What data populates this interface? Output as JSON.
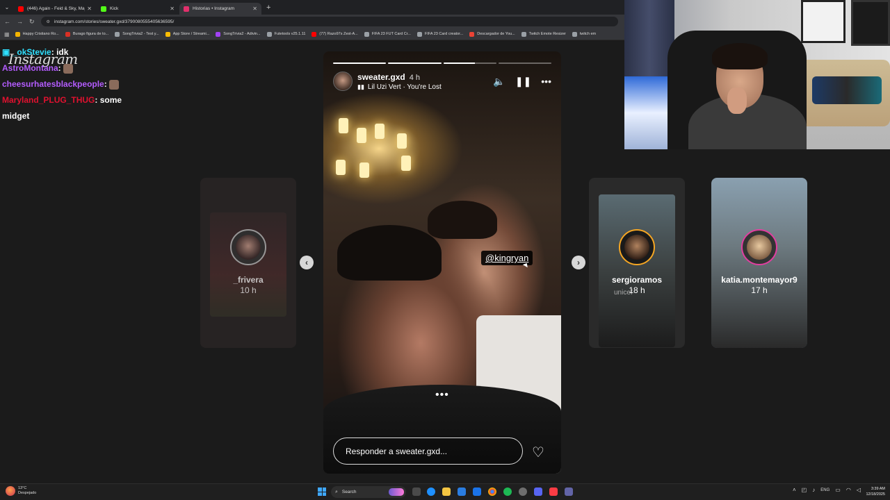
{
  "browser": {
    "tabs": [
      {
        "label": "(446) Again - Feid & Sky, Majo",
        "favicon_color": "#ff0000",
        "active": false
      },
      {
        "label": "Kick",
        "favicon_color": "#53fc18",
        "active": false
      },
      {
        "label": "Historias • Instagram",
        "favicon_color": "#e1306c",
        "active": true
      }
    ],
    "url": "instagram.com/stories/sweater.gxd/3790080555405636595/",
    "bookmarks": [
      {
        "label": "Happy Cristiano Ro...",
        "color": "#f4b400"
      },
      {
        "label": "Burago figura de to...",
        "color": "#d93025"
      },
      {
        "label": "SongTrivia2 - Test y...",
        "color": "#9aa0a6"
      },
      {
        "label": "App Store / Streami...",
        "color": "#fbbc04"
      },
      {
        "label": "SongTrivia2 - Adivin...",
        "color": "#a142f4"
      },
      {
        "label": "Futetools v25.1.11",
        "color": "#9aa0a6"
      },
      {
        "label": "(77) Razo97s Zest-A...",
        "color": "#ff0000"
      },
      {
        "label": "FIFA 23 FUT Card Cr...",
        "color": "#9aa0a6"
      },
      {
        "label": "FIFA 23 Card creator...",
        "color": "#9aa0a6"
      },
      {
        "label": "Descargador de You...",
        "color": "#ea4335"
      },
      {
        "label": "Twitch Emote Resizer",
        "color": "#9aa0a6"
      },
      {
        "label": "twitch em",
        "color": "#9aa0a6"
      }
    ]
  },
  "chat": {
    "watermark": "Instagram",
    "messages": [
      {
        "user": "_okStevie",
        "text": ": idk"
      },
      {
        "user": "AstroMontana",
        "text": ":"
      },
      {
        "user": "cheesurhatesblackpeople",
        "text": ":"
      },
      {
        "user": "Maryland_PLUG_THUG",
        "text": ": some midget"
      }
    ]
  },
  "stories": {
    "prev": {
      "name": "_frivera",
      "time": "10 h"
    },
    "next1": {
      "name": "sergioramos",
      "time": "18 h"
    },
    "next2": {
      "name": "katia.montemayor9",
      "time": "17 h"
    }
  },
  "main_story": {
    "username": "sweater.gxd",
    "time": "4 h",
    "song": "Lil Uzi Vert · You're Lost",
    "mention": "@kingryan",
    "reply_placeholder": "Responder a sweater.gxd...",
    "progress": [
      1.0,
      1.0,
      0.6,
      0.0
    ],
    "icons": {
      "sound": "speaker-icon",
      "pause": "pause-icon",
      "more": "more-icon",
      "like": "heart-icon"
    }
  },
  "taskbar": {
    "weather_temp": "13°C",
    "weather_desc": "Despejado",
    "search_label": "Search",
    "language": "ENG",
    "time": "3:39 AM",
    "date": "12/18/2025"
  }
}
